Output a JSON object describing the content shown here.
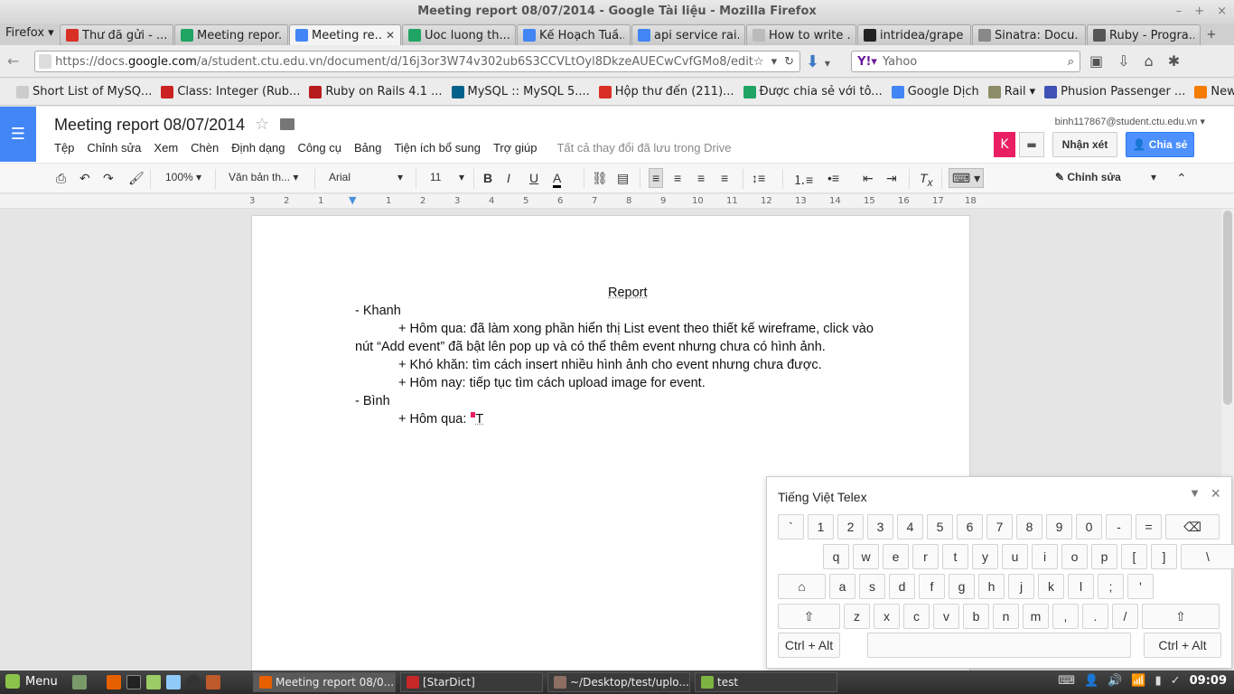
{
  "window": {
    "title": "Meeting report 08/07/2014 - Google Tài liệu - Mozilla Firefox"
  },
  "browser": {
    "menu_label": "Firefox",
    "tabs": [
      {
        "label": "Thư đã gửi - ...",
        "icon": "gmail-icon",
        "color": "#d93025"
      },
      {
        "label": "Meeting repor...",
        "icon": "drive-icon",
        "color": "#1fa463"
      },
      {
        "label": "Meeting re...",
        "icon": "docs-icon",
        "color": "#4285f4",
        "active": true
      },
      {
        "label": "Uoc luong th...",
        "icon": "drive-icon",
        "color": "#1fa463"
      },
      {
        "label": "Kế Hoạch Tuầ...",
        "icon": "docs-icon",
        "color": "#4285f4"
      },
      {
        "label": "api service rai...",
        "icon": "google-icon",
        "color": "#4285f4"
      },
      {
        "label": "How to write ...",
        "icon": "page-icon",
        "color": "#bbbbbb"
      },
      {
        "label": "intridea/grape",
        "icon": "github-icon",
        "color": "#222222"
      },
      {
        "label": "Sinatra: Docu...",
        "icon": "sinatra-icon",
        "color": "#888888"
      },
      {
        "label": "Ruby - Progra...",
        "icon": "game-icon",
        "color": "#555555"
      }
    ],
    "url_prefix": "https://docs.",
    "url_host": "google.com",
    "url_suffix": "/a/student.ctu.edu.vn/document/d/16j3or3W74v302ub6S3CCVLtOyl8DkzeAUECwCvfGMo8/edit",
    "search_engine": "Y!",
    "search_placeholder": "Yahoo",
    "bookmarks": [
      {
        "label": "Short List of MySQ...",
        "icon": "page-icon",
        "color": "#cccccc"
      },
      {
        "label": "Class: Integer (Rub...",
        "icon": "ruby-icon",
        "color": "#cc2222"
      },
      {
        "label": "Ruby on Rails 4.1 ...",
        "icon": "rails-icon",
        "color": "#b71c1c"
      },
      {
        "label": "MySQL :: MySQL 5....",
        "icon": "mysql-icon",
        "color": "#00618a"
      },
      {
        "label": "Hộp thư đến (211)...",
        "icon": "gmail-icon",
        "color": "#d93025"
      },
      {
        "label": "Được chia sẻ với tô...",
        "icon": "drive-icon",
        "color": "#1fa463"
      },
      {
        "label": "Google Dịch",
        "icon": "translate-icon",
        "color": "#4285f4"
      },
      {
        "label": "Rail",
        "icon": "folder-icon",
        "color": "#8d8d6a",
        "dropdown": true
      },
      {
        "label": "Phusion Passenger ...",
        "icon": "passenger-icon",
        "color": "#3f51b5"
      },
      {
        "label": "News",
        "icon": "rss-icon",
        "color": "#f57c00",
        "dropdown": true
      }
    ]
  },
  "docs": {
    "title": "Meeting report 08/07/2014",
    "menu": [
      "Tệp",
      "Chỉnh sửa",
      "Xem",
      "Chèn",
      "Định dạng",
      "Công cụ",
      "Bảng",
      "Tiện ích bổ sung",
      "Trợ giúp"
    ],
    "save_status": "Tất cả thay đổi đã lưu trong Drive",
    "account_email": "binh117867@student.ctu.edu.vn",
    "avatar_letter": "K",
    "comment_label": "Nhận xét",
    "share_label": "Chia sẻ",
    "toolbar": {
      "zoom": "100%",
      "style": "Văn bản th...",
      "font": "Arial",
      "size": "11",
      "mode": "Chỉnh sửa"
    },
    "ruler_numbers": [
      "3",
      "2",
      "1",
      "1",
      "2",
      "3",
      "4",
      "5",
      "6",
      "7",
      "8",
      "9",
      "10",
      "11",
      "12",
      "13",
      "14",
      "15",
      "16",
      "17",
      "18"
    ]
  },
  "document": {
    "heading": "Report",
    "lines": [
      "- Khanh",
      "+ Hôm qua: đã làm xong phần hiển thị List event theo thiết kế wireframe, click vào",
      "nút “Add event” đã bật lên pop up và có thể thêm event nhưng chưa có hình ảnh.",
      "+ Khó khăn: tìm cách insert nhiều hình ảnh cho event nhưng chưa được.",
      "+ Hôm nay: tiếp tục tìm cách upload image for event.",
      "- Bình",
      "+ Hôm qua: ",
      "T"
    ]
  },
  "keyboard": {
    "title": "Tiếng Việt Telex",
    "row1": [
      "`",
      "1",
      "2",
      "3",
      "4",
      "5",
      "6",
      "7",
      "8",
      "9",
      "0",
      "-",
      "=",
      "⌫"
    ],
    "row2": [
      "q",
      "w",
      "e",
      "r",
      "t",
      "y",
      "u",
      "i",
      "o",
      "p",
      "[",
      "]",
      "\\"
    ],
    "row3": [
      "⌂",
      "a",
      "s",
      "d",
      "f",
      "g",
      "h",
      "j",
      "k",
      "l",
      ";",
      "'"
    ],
    "row4": [
      "⇧",
      "z",
      "x",
      "c",
      "v",
      "b",
      "n",
      "m",
      ",",
      ".",
      "/",
      "⇧"
    ],
    "ctrl_alt": "Ctrl + Alt"
  },
  "taskbar": {
    "menu_label": "Menu",
    "tasks": [
      {
        "label": "Meeting report 08/0...",
        "active": true,
        "color": "#e66000"
      },
      {
        "label": "[StarDict]",
        "active": false,
        "color": "#c62828"
      },
      {
        "label": "~/Desktop/test/uplo...",
        "active": false,
        "color": "#8d6e63"
      },
      {
        "label": "test",
        "active": false,
        "color": "#7cb342"
      }
    ],
    "clock": "09:09"
  }
}
